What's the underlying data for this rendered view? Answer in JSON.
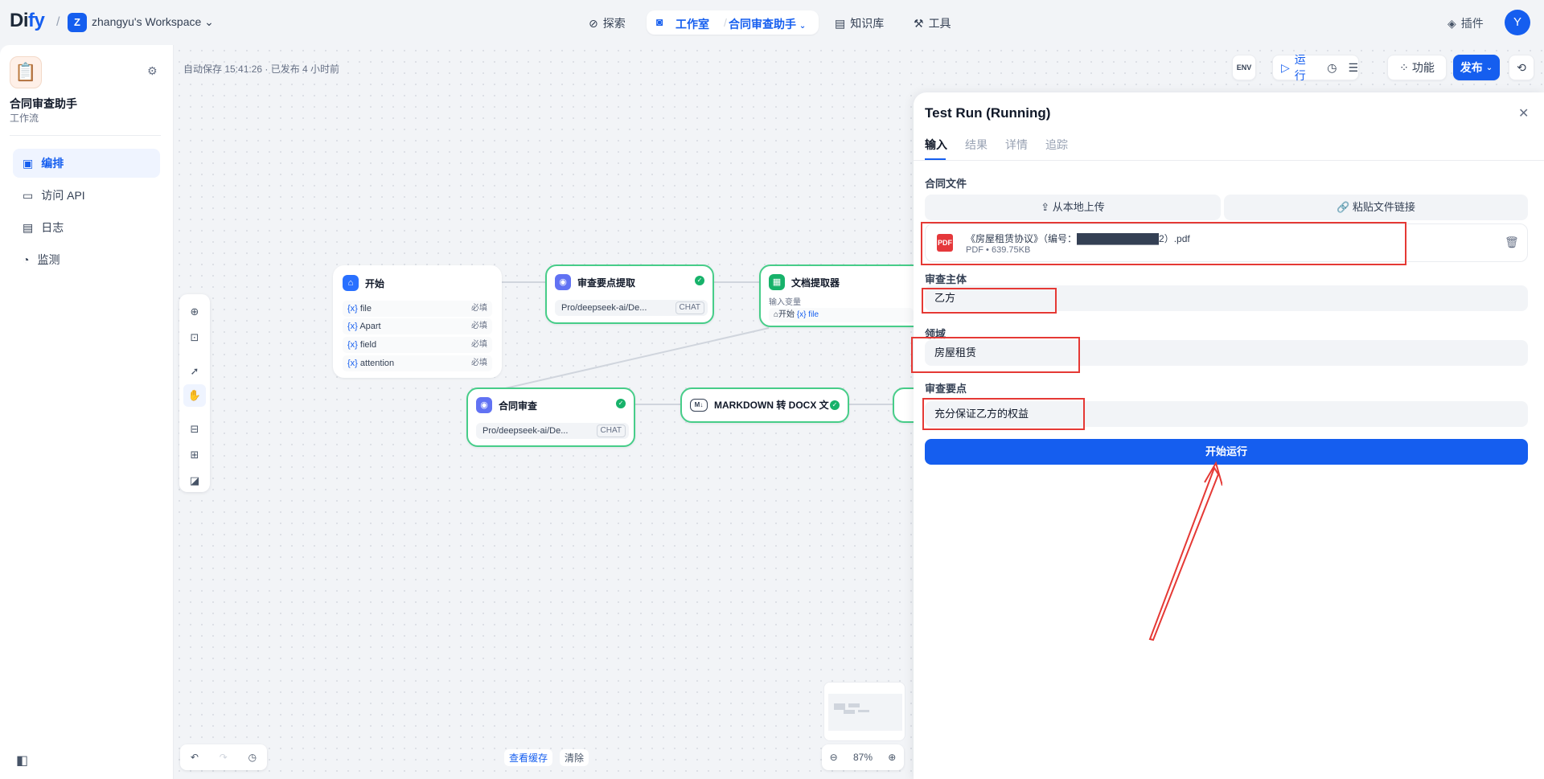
{
  "header": {
    "logo_main": "Di",
    "logo_accent": "fy",
    "workspace_initial": "Z",
    "workspace_name": "zhangyu's Workspace",
    "nav": {
      "explore": "探索",
      "studio": "工作室",
      "current_app": "合同审查助手",
      "knowledge": "知识库",
      "tools": "工具"
    },
    "plugins": "插件",
    "user_initial": "Y"
  },
  "sidebar": {
    "app_name": "合同审查助手",
    "app_type": "工作流",
    "items": [
      {
        "label": "编排",
        "icon": "layout-icon",
        "active": true
      },
      {
        "label": "访问 API",
        "icon": "terminal-icon",
        "active": false
      },
      {
        "label": "日志",
        "icon": "file-icon",
        "active": false
      },
      {
        "label": "监测",
        "icon": "gauge-icon",
        "active": false
      }
    ]
  },
  "toolbar": {
    "autosave": "自动保存 15:41:26 · 已发布 4 小时前",
    "env": "ENV",
    "run": "运行",
    "features": "功能",
    "publish": "发布"
  },
  "nodes": {
    "start": {
      "title": "开始",
      "vars": [
        {
          "name": "file",
          "req": "必填"
        },
        {
          "name": "Apart",
          "req": "必填"
        },
        {
          "name": "field",
          "req": "必填"
        },
        {
          "name": "attention",
          "req": "必填"
        }
      ]
    },
    "extract": {
      "title": "审查要点提取",
      "model": "Pro/deepseek-ai/De...",
      "tag": "CHAT"
    },
    "doc": {
      "title": "文档提取器",
      "input_label": "输入变量",
      "input_src": "开始",
      "input_var": "{x} file"
    },
    "review": {
      "title": "合同审查",
      "model": "Pro/deepseek-ai/De...",
      "tag": "CHAT"
    },
    "md": {
      "title": "MARKDOWN 转 DOCX 文"
    }
  },
  "canvas_bottom": {
    "view_cache": "查看缓存",
    "clear": "清除",
    "zoom": "87%"
  },
  "panel": {
    "title": "Test Run (Running)",
    "tabs": [
      "输入",
      "结果",
      "详情",
      "追踪"
    ],
    "file_label": "合同文件",
    "upload_local": "从本地上传",
    "paste_link": "粘贴文件链接",
    "file_name": "《房屋租赁协议》（编号：████████████2）.pdf",
    "file_meta": "PDF • 639.75KB",
    "subject_label": "审查主体",
    "subject_value": "乙方",
    "domain_label": "领域",
    "domain_value": "房屋租赁",
    "points_label": "审查要点",
    "points_value": "充分保证乙方的权益",
    "run_button": "开始运行"
  },
  "colors": {
    "accent": "#155eef",
    "success": "#17b26a",
    "annotation": "#e53935"
  }
}
